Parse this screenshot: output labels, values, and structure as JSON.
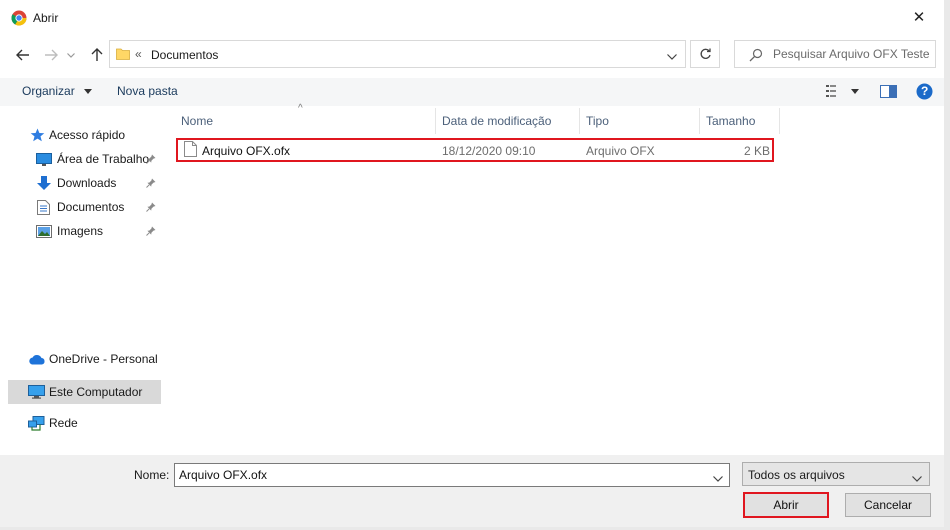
{
  "window": {
    "title": "Abrir",
    "close_glyph": "✕"
  },
  "address_bar": {
    "overflow_glyph": "«",
    "path_segment": "Documentos"
  },
  "search": {
    "placeholder": "Pesquisar Arquivo OFX Teste"
  },
  "toolbar": {
    "organize_label": "Organizar",
    "new_folder_label": "Nova pasta",
    "help_glyph": "?"
  },
  "navigation": {
    "quick_access": "Acesso rápido",
    "pinned_items": [
      {
        "label": "Área de Trabalho",
        "icon": "desktop-icon"
      },
      {
        "label": "Downloads",
        "icon": "download-icon"
      },
      {
        "label": "Documentos",
        "icon": "document-icon"
      },
      {
        "label": "Imagens",
        "icon": "pictures-icon"
      }
    ],
    "onedrive": "OneDrive - Personal",
    "this_pc": "Este Computador",
    "network": "Rede"
  },
  "file_list": {
    "columns": [
      "Nome",
      "Data de modificação",
      "Tipo",
      "Tamanho"
    ],
    "sort_glyph": "^",
    "rows": [
      {
        "name": "Arquivo OFX.ofx",
        "modified": "18/12/2020 09:10",
        "type": "Arquivo OFX",
        "size": "2 KB"
      }
    ]
  },
  "footer": {
    "name_label": "Nome:",
    "name_value": "Arquivo OFX.ofx",
    "filter_value": "Todos os arquivos",
    "open_label": "Abrir",
    "cancel_label": "Cancelar"
  },
  "colors": {
    "highlight_border": "#e0161f",
    "selected_nav_bg": "#d9d9d9",
    "help_blue": "#1b6ac9"
  }
}
